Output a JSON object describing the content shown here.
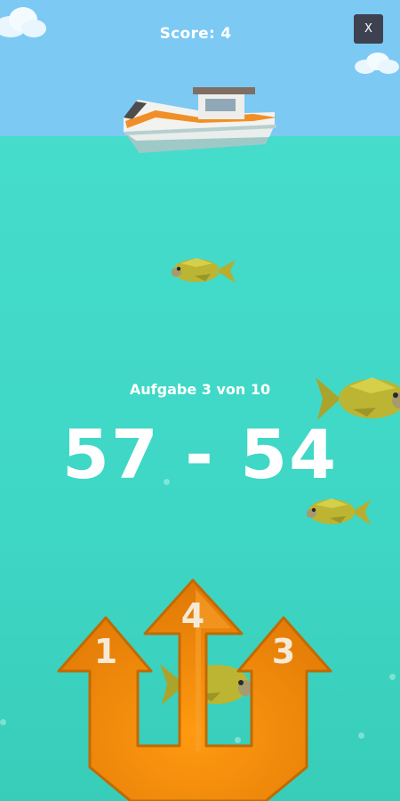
{
  "hud": {
    "score_text": "Score: 4",
    "close_label": "X"
  },
  "task": {
    "progress_text": "Aufgabe 3 von 10",
    "equation": "57 - 54"
  },
  "answers": [
    "1",
    "4",
    "3"
  ]
}
